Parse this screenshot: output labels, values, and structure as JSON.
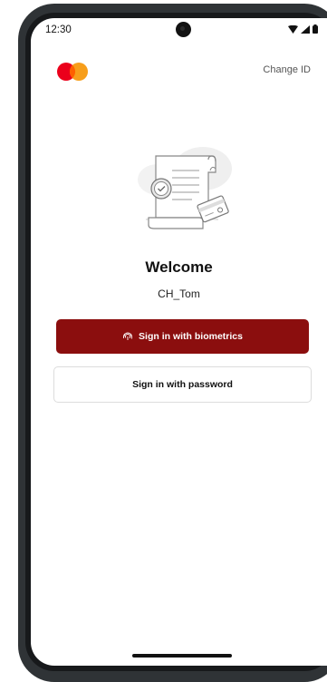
{
  "status_bar": {
    "time": "12:30",
    "icons": [
      "wifi-icon",
      "signal-icon",
      "battery-icon"
    ]
  },
  "header": {
    "logo": "mastercard-logo",
    "change_id_label": "Change ID"
  },
  "main": {
    "illustration": "document-card-illustration",
    "welcome_title": "Welcome",
    "username": "CH_Tom",
    "biometric_button_label": "Sign in with biometrics",
    "password_button_label": "Sign in with password"
  },
  "colors": {
    "primary_button": "#8b0e0e",
    "logo_red": "#eb001b",
    "logo_orange": "#f79e1b"
  }
}
